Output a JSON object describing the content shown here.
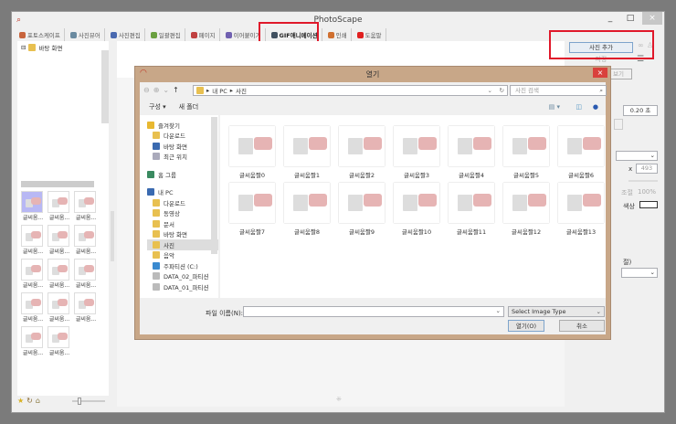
{
  "app": {
    "title": "PhotoScape",
    "minimize": "_",
    "maximize": "□",
    "close": "×"
  },
  "tabs": [
    {
      "label": "포토스케이프",
      "color": "#c8643c"
    },
    {
      "label": "사진뷰어",
      "color": "#6a8aa0"
    },
    {
      "label": "사진편집",
      "color": "#4a6ab0"
    },
    {
      "label": "일괄편집",
      "color": "#6aa040"
    },
    {
      "label": "페이지",
      "color": "#c04040"
    },
    {
      "label": "이어붙이기",
      "color": "#7060b0"
    },
    {
      "label": "GIF애니메이션",
      "color": "#405060"
    },
    {
      "label": "인쇄",
      "color": "#d07030"
    },
    {
      "label": "도움말",
      "color": "#e02020"
    }
  ],
  "left_tree": {
    "item": "바탕 화면"
  },
  "left_thumbs": [
    "글씨움...",
    "글씨움...",
    "글씨움...",
    "글씨움...",
    "글씨움...",
    "글씨움...",
    "글씨움...",
    "글씨움...",
    "글씨움...",
    "글씨움...",
    "글씨움...",
    "글씨움...",
    "글씨움...",
    "글씨움..."
  ],
  "right_panel": {
    "add_photo": "사진 추가",
    "save": "저장",
    "preview": "보기",
    "delay": "0.20 초",
    "x_label": "x",
    "height": "493",
    "size_label": "조절",
    "percent": "100%",
    "color_label": "색상",
    "option_label": "절)"
  },
  "dialog": {
    "title": "열기",
    "close": "×",
    "breadcrumb": [
      "내 PC",
      "사진"
    ],
    "search_placeholder": "사진 검색",
    "organize": "구성 ▾",
    "new_folder": "새 폴더",
    "nav": {
      "favorites": "즐겨찾기",
      "fav_items": [
        "다운로드",
        "바탕 화면",
        "최근 위치"
      ],
      "homegroup": "홈 그룹",
      "pc": "내 PC",
      "pc_items": [
        "다운로드",
        "동영상",
        "문서",
        "바탕 화면",
        "사진",
        "음악",
        "주파티션 (C:)",
        "DATA_02_파티션",
        "DATA_01_파티션"
      ]
    },
    "files": [
      "글씨움짤0",
      "글씨움짤1",
      "글씨움짤2",
      "글씨움짤3",
      "글씨움짤4",
      "글씨움짤5",
      "글씨움짤6",
      "글씨움짤7",
      "글씨움짤8",
      "글씨움짤9",
      "글씨움짤10",
      "글씨움짤11",
      "글씨움짤12",
      "글씨움짤13"
    ],
    "filename_label": "파일 이름(N):",
    "filename_value": "",
    "filetype": "Select Image Type",
    "open": "열기(O)",
    "cancel": "취소"
  },
  "colors": {
    "dialog_frame": "#c8a788",
    "highlight": "#e0182a",
    "close_red": "#d9413c"
  }
}
